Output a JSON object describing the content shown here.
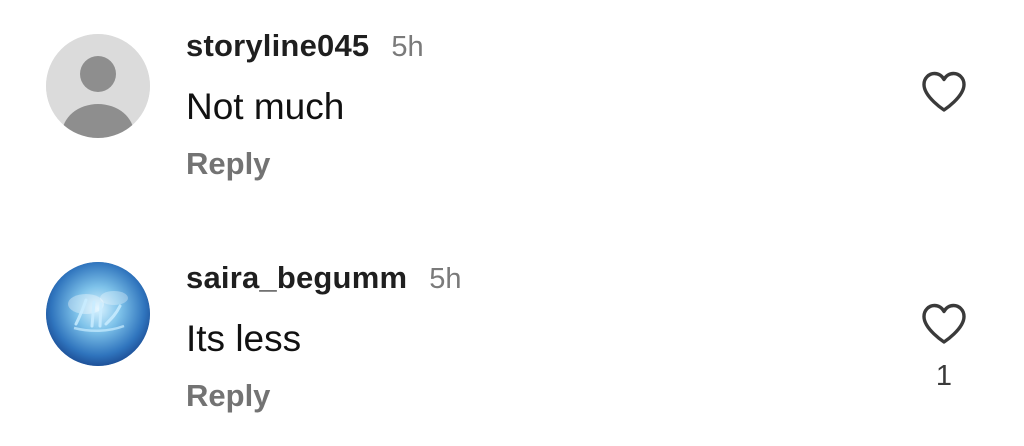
{
  "comments": [
    {
      "username": "storyline045",
      "time": "5h",
      "text": "Not much",
      "reply_label": "Reply",
      "likes": "",
      "avatar": "default-user-avatar"
    },
    {
      "username": "saira_begumm",
      "time": "5h",
      "text": "Its less",
      "reply_label": "Reply",
      "likes": "1",
      "avatar": "blue-calligraphy-avatar"
    }
  ],
  "colors": {
    "username": "#1f1f1f",
    "time": "#7a7a7a",
    "reply": "#737373",
    "default_avatar_bg": "#dbdbdb",
    "default_avatar_fg": "#8e8e8e",
    "like_icon": "#3a3a3a"
  },
  "icons": {
    "like": "heart-outline-icon"
  }
}
